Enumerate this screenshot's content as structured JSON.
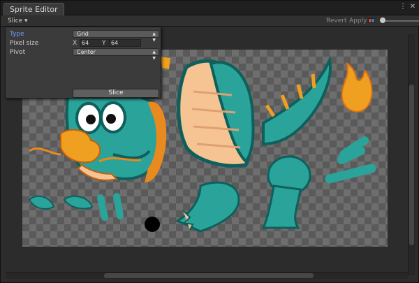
{
  "window": {
    "tab_title": "Sprite Editor",
    "controls": {
      "menu_glyph": "⋮",
      "close_glyph": "✕"
    }
  },
  "toolbar": {
    "slice_menu": "Slice ▾",
    "revert_label": "Revert",
    "apply_label": "Apply",
    "color_swatches": [
      "#c84a3a",
      "#3a7ad0"
    ]
  },
  "slice_panel": {
    "type_label": "Type",
    "type_value": "Grid",
    "pixel_size_label": "Pixel size",
    "pixel_x_label": "X",
    "pixel_x_value": "64",
    "pixel_y_label": "Y",
    "pixel_y_value": "64",
    "pivot_label": "Pivot",
    "pivot_value": "Center",
    "slice_button": "Slice"
  },
  "colors": {
    "dragon_teal": "#2aa39a",
    "dragon_dark_teal": "#0f5f5c",
    "belly_peach": "#f6c493",
    "fire_orange": "#f0a020",
    "mane_orange": "#e88a1f",
    "accent_blue": "#6e9bff"
  }
}
